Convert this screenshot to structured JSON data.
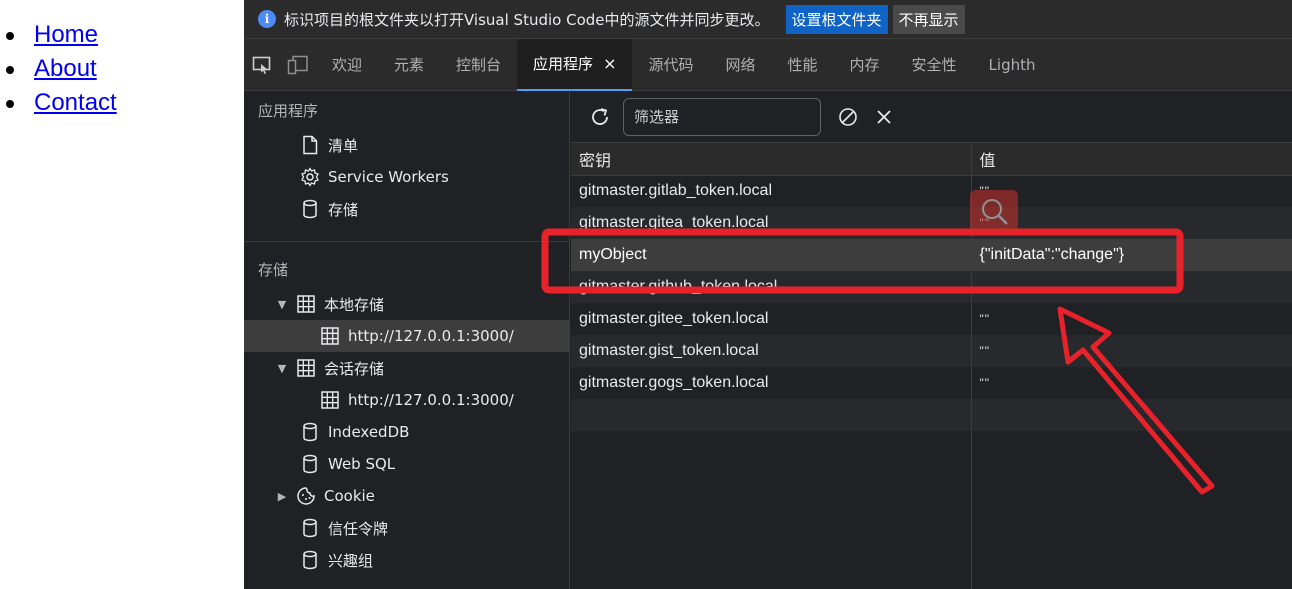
{
  "page_nav": {
    "links": [
      "Home",
      "About",
      "Contact"
    ]
  },
  "infobar": {
    "message": "标识项目的根文件夹以打开Visual Studio Code中的源文件并同步更改。",
    "set_root_label": "设置根文件夹",
    "dismiss_label": "不再显示",
    "icon": "info-icon"
  },
  "tabs": [
    {
      "label": "欢迎",
      "active": false
    },
    {
      "label": "元素",
      "active": false
    },
    {
      "label": "控制台",
      "active": false
    },
    {
      "label": "应用程序",
      "active": true,
      "close": "×"
    },
    {
      "label": "源代码",
      "active": false
    },
    {
      "label": "网络",
      "active": false
    },
    {
      "label": "性能",
      "active": false
    },
    {
      "label": "内存",
      "active": false
    },
    {
      "label": "安全性",
      "active": false
    },
    {
      "label": "Lighth",
      "active": false
    }
  ],
  "sidebar": {
    "app_section": "应用程序",
    "app_items": [
      {
        "label": "清单",
        "icon": "document-icon"
      },
      {
        "label": "Service Workers",
        "icon": "gear-icon"
      },
      {
        "label": "存储",
        "icon": "database-icon"
      }
    ],
    "storage_section": "存储",
    "local_storage": "本地存储",
    "local_storage_origin": "http://127.0.0.1:3000/",
    "session_storage": "会话存储",
    "session_storage_origin": "http://127.0.0.1:3000/",
    "indexeddb": "IndexedDB",
    "websql": "Web SQL",
    "cookie": "Cookie",
    "trust_tokens": "信任令牌",
    "interest_groups": "兴趣组"
  },
  "toolbar": {
    "filter_placeholder": "筛选器"
  },
  "table": {
    "key_header": "密钥",
    "value_header": "值",
    "rows": [
      {
        "key": "gitmaster.gitlab_token.local",
        "value": "\"\""
      },
      {
        "key": "gitmaster.gitea_token.local",
        "value": "\"\""
      },
      {
        "key": "myObject",
        "value": "{\"initData\":\"change\"}"
      },
      {
        "key": "gitmaster.github_token.local",
        "value": ""
      },
      {
        "key": "gitmaster.gitee_token.local",
        "value": "\"\""
      },
      {
        "key": "gitmaster.gist_token.local",
        "value": "\"\""
      },
      {
        "key": "gitmaster.gogs_token.local",
        "value": "\"\""
      }
    ]
  },
  "annotation": {
    "color": "#e8222b"
  }
}
